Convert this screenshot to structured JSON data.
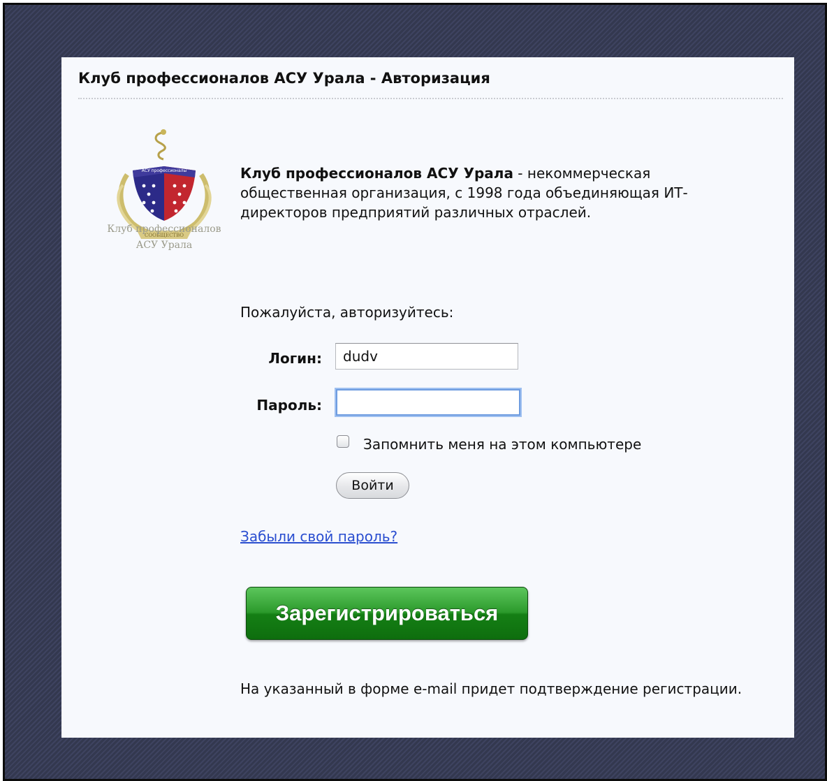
{
  "page": {
    "title": "Клуб профессионалов АСУ Урала - Авторизация"
  },
  "logo": {
    "shield_text": "АСУ профессионалы",
    "ribbon_text": "СООБЩЕСТВО",
    "caption_line1": "Клуб профессионалов",
    "caption_line2": "АСУ Урала"
  },
  "intro": {
    "org_name": "Клуб профессионалов АСУ Урала",
    "description": " - некоммерческая общественная организация, с 1998 года объединяющая ИТ-директоров предприятий различных отраслей."
  },
  "form": {
    "prompt": "Пожалуйста, авторизуйтесь:",
    "login_label": "Логин:",
    "login_value": "dudv",
    "password_label": "Пароль:",
    "password_value": "",
    "remember_label": "Запомнить меня на этом компьютере",
    "remember_checked": false,
    "submit_label": "Войти"
  },
  "links": {
    "forgot_password": "Забыли свой пароль?"
  },
  "register": {
    "button_label": "Зарегистрироваться",
    "note": "На указанный в форме e-mail придет подтверждение регистрации."
  },
  "colors": {
    "background": "#383d58",
    "panel": "#f7f9fd",
    "link": "#2a4ed0",
    "register_button": "#1f8a1f",
    "focus_ring": "#6e9ce0"
  }
}
